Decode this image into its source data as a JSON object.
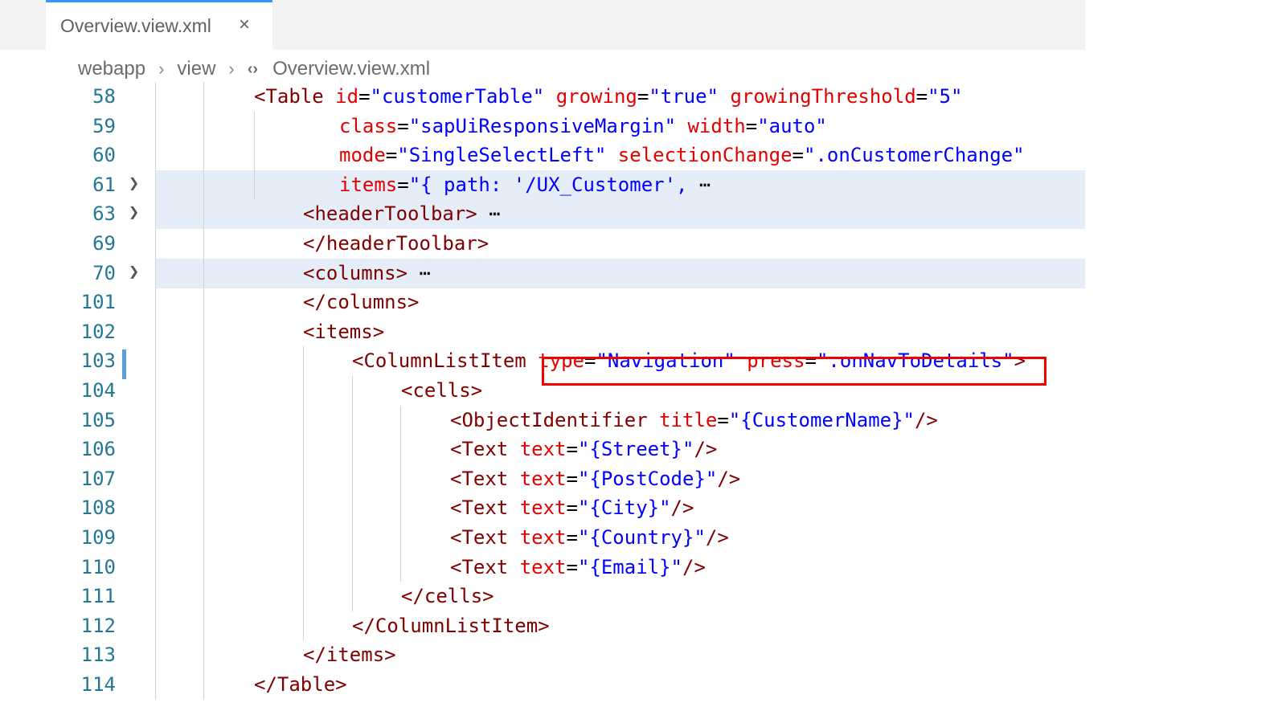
{
  "tab": {
    "title": "Overview.view.xml",
    "close_glyph": "×"
  },
  "breadcrumb": [
    "webapp",
    "view",
    "Overview.view.xml"
  ],
  "lines": [
    {
      "num": "58",
      "tokens": [
        [
          "t",
          "<Table "
        ],
        [
          "a",
          "id"
        ],
        [
          "e",
          "="
        ],
        [
          "v",
          "\"customerTable\" "
        ],
        [
          "a",
          "growing"
        ],
        [
          "e",
          "="
        ],
        [
          "v",
          "\"true\" "
        ],
        [
          "a",
          "growingThreshold"
        ],
        [
          "e",
          "="
        ],
        [
          "v",
          "\"5\""
        ]
      ]
    },
    {
      "num": "59",
      "tokens": [
        [
          "a",
          "class"
        ],
        [
          "e",
          "="
        ],
        [
          "v",
          "\"sapUiResponsiveMargin\" "
        ],
        [
          "a",
          "width"
        ],
        [
          "e",
          "="
        ],
        [
          "v",
          "\"auto\""
        ]
      ]
    },
    {
      "num": "60",
      "tokens": [
        [
          "a",
          "mode"
        ],
        [
          "e",
          "="
        ],
        [
          "v",
          "\"SingleSelectLeft\" "
        ],
        [
          "a",
          "selectionChange"
        ],
        [
          "e",
          "="
        ],
        [
          "v",
          "\".onCustomerChange\""
        ]
      ]
    },
    {
      "num": "61",
      "tokens": [
        [
          "a",
          "items"
        ],
        [
          "e",
          "="
        ],
        [
          "v",
          "\"{ path: '/UX_Customer',"
        ],
        [
          "e",
          " ⋯"
        ]
      ]
    },
    {
      "num": "63",
      "tokens": [
        [
          "t",
          "<headerToolbar>"
        ],
        [
          "e",
          " ⋯"
        ]
      ]
    },
    {
      "num": "69",
      "tokens": [
        [
          "t",
          "</headerToolbar>"
        ]
      ]
    },
    {
      "num": "70",
      "tokens": [
        [
          "t",
          "<columns>"
        ],
        [
          "e",
          " ⋯"
        ]
      ]
    },
    {
      "num": "101",
      "tokens": [
        [
          "t",
          "</columns>"
        ]
      ]
    },
    {
      "num": "102",
      "tokens": [
        [
          "t",
          "<items>"
        ]
      ]
    },
    {
      "num": "103",
      "tokens": [
        [
          "t",
          "<ColumnListItem "
        ],
        [
          "a",
          "type"
        ],
        [
          "e",
          "="
        ],
        [
          "v",
          "\"Navigation\" "
        ],
        [
          "a",
          "press"
        ],
        [
          "e",
          "="
        ],
        [
          "v",
          "\".onNavToDetails\""
        ],
        [
          "t",
          ">"
        ]
      ]
    },
    {
      "num": "104",
      "tokens": [
        [
          "t",
          "<cells>"
        ]
      ]
    },
    {
      "num": "105",
      "tokens": [
        [
          "t",
          "<ObjectIdentifier "
        ],
        [
          "a",
          "title"
        ],
        [
          "e",
          "="
        ],
        [
          "v",
          "\"{CustomerName}\""
        ],
        [
          "t",
          "/>"
        ]
      ]
    },
    {
      "num": "106",
      "tokens": [
        [
          "t",
          "<Text "
        ],
        [
          "a",
          "text"
        ],
        [
          "e",
          "="
        ],
        [
          "v",
          "\"{Street}\""
        ],
        [
          "t",
          "/>"
        ]
      ]
    },
    {
      "num": "107",
      "tokens": [
        [
          "t",
          "<Text "
        ],
        [
          "a",
          "text"
        ],
        [
          "e",
          "="
        ],
        [
          "v",
          "\"{PostCode}\""
        ],
        [
          "t",
          "/>"
        ]
      ]
    },
    {
      "num": "108",
      "tokens": [
        [
          "t",
          "<Text "
        ],
        [
          "a",
          "text"
        ],
        [
          "e",
          "="
        ],
        [
          "v",
          "\"{City}\""
        ],
        [
          "t",
          "/>"
        ]
      ]
    },
    {
      "num": "109",
      "tokens": [
        [
          "t",
          "<Text "
        ],
        [
          "a",
          "text"
        ],
        [
          "e",
          "="
        ],
        [
          "v",
          "\"{Country}\""
        ],
        [
          "t",
          "/>"
        ]
      ]
    },
    {
      "num": "110",
      "tokens": [
        [
          "t",
          "<Text "
        ],
        [
          "a",
          "text"
        ],
        [
          "e",
          "="
        ],
        [
          "v",
          "\"{Email}\""
        ],
        [
          "t",
          "/>"
        ]
      ]
    },
    {
      "num": "111",
      "tokens": [
        [
          "t",
          "</cells>"
        ]
      ]
    },
    {
      "num": "112",
      "tokens": [
        [
          "t",
          "</ColumnListItem>"
        ]
      ]
    },
    {
      "num": "113",
      "tokens": [
        [
          "t",
          "</items>"
        ]
      ]
    },
    {
      "num": "114",
      "tokens": [
        [
          "t",
          "</Table>"
        ]
      ]
    }
  ],
  "folded_lines": [
    "61",
    "63",
    "70"
  ],
  "highlighted_lines": [
    "61",
    "63",
    "70"
  ],
  "modified_line": "103",
  "fold_icon": "chevron-right-icon",
  "colors": {
    "tag": "#800000",
    "attribute": "#e50000",
    "value": "#0000ff",
    "line_number": "#237893",
    "highlight_box": "#ee0000",
    "folded_background": "#e5eef8"
  }
}
